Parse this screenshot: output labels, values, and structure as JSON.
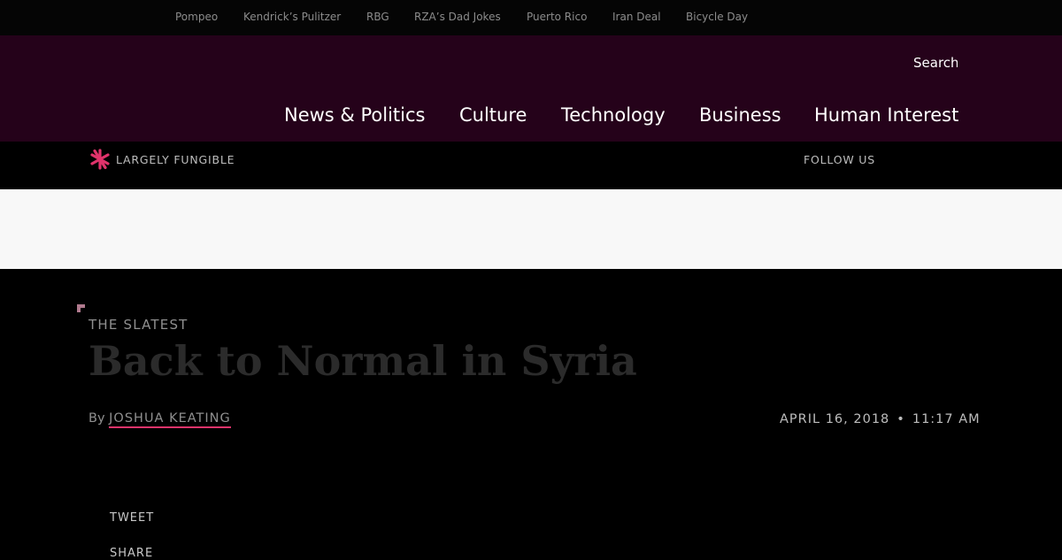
{
  "trending": [
    "Pompeo",
    "Kendrick’s Pulitzer",
    "RBG",
    "RZA’s Dad Jokes",
    "Puerto Rico",
    "Iran Deal",
    "Bicycle Day"
  ],
  "search_label": "Search",
  "nav": [
    "News & Politics",
    "Culture",
    "Technology",
    "Business",
    "Human Interest"
  ],
  "brand_name": "LARGELY FUNGIBLE",
  "follow_label": "FOLLOW US",
  "article": {
    "kicker": "THE SLATEST",
    "headline": "Back to Normal in Syria",
    "by_label": "By",
    "author": "JOSHUA KEATING",
    "date": "APRIL 16, 2018",
    "separator": "•",
    "time": "11:17 AM"
  },
  "social": {
    "tweet": "TWEET",
    "share": "SHARE"
  },
  "colors": {
    "masthead": "#25021a",
    "accent": "#e0336b",
    "ad_band": "#f8f8f8"
  }
}
